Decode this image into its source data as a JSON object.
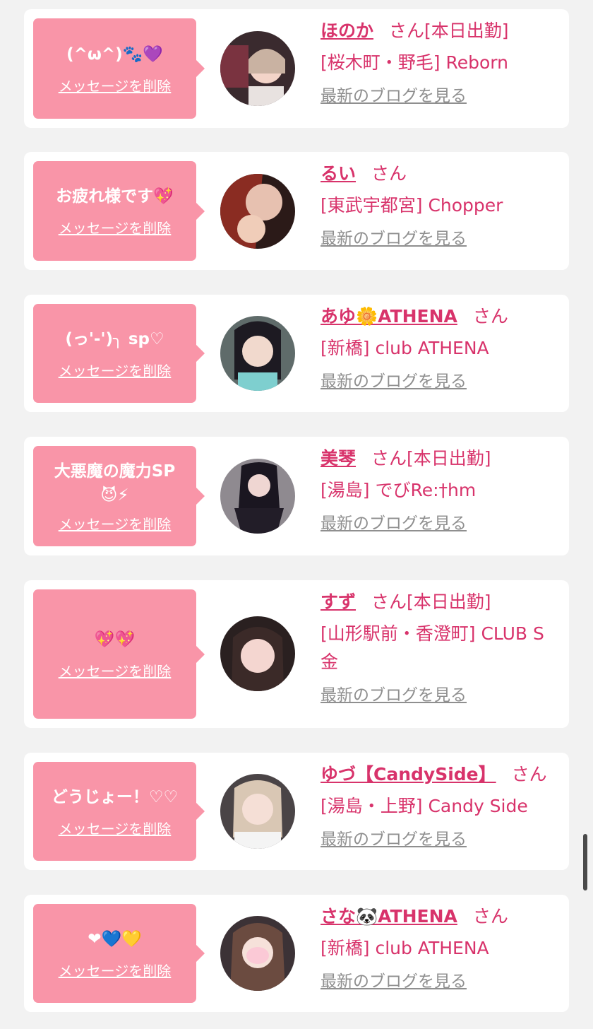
{
  "common": {
    "delete_label": "メッセージを削除",
    "blog_label": "最新のブログを見る",
    "san": "さん"
  },
  "colors": {
    "background": "#f2f2f2",
    "card": "#ffffff",
    "bubble": "#f995a8",
    "accent": "#d8336b",
    "link_gray": "#8f8f8f"
  },
  "items": [
    {
      "message": "(^ω^)🐾💜",
      "name": "ほのか",
      "status": "[本日出勤]",
      "shop": "[桜木町・野毛] Reborn"
    },
    {
      "message": "お疲れ様です💖",
      "name": "るい",
      "status": "",
      "shop": "[東武宇都宮] Chopper"
    },
    {
      "message": "(っ'-')╮ sp♡",
      "name": "あゆ🌼ATHENA",
      "status": "",
      "shop": "[新橋] club ATHENA"
    },
    {
      "message": "大悪魔の魔力SP\n😈⚡",
      "name": "美琴",
      "status": "[本日出勤]",
      "shop": "[湯島] でびRe:†hm"
    },
    {
      "message": "💖💖",
      "name": "すず",
      "status": "[本日出勤]",
      "shop": "[山形駅前・香澄町] CLUB S金"
    },
    {
      "message": "どうじょー！♡♡",
      "name": "ゆづ【CandySide】",
      "status": "",
      "shop": "[湯島・上野] Candy Side"
    },
    {
      "message": "❤💙💛",
      "name": "さな🐼ATHENA",
      "status": "",
      "shop": "[新橋] club ATHENA"
    }
  ]
}
